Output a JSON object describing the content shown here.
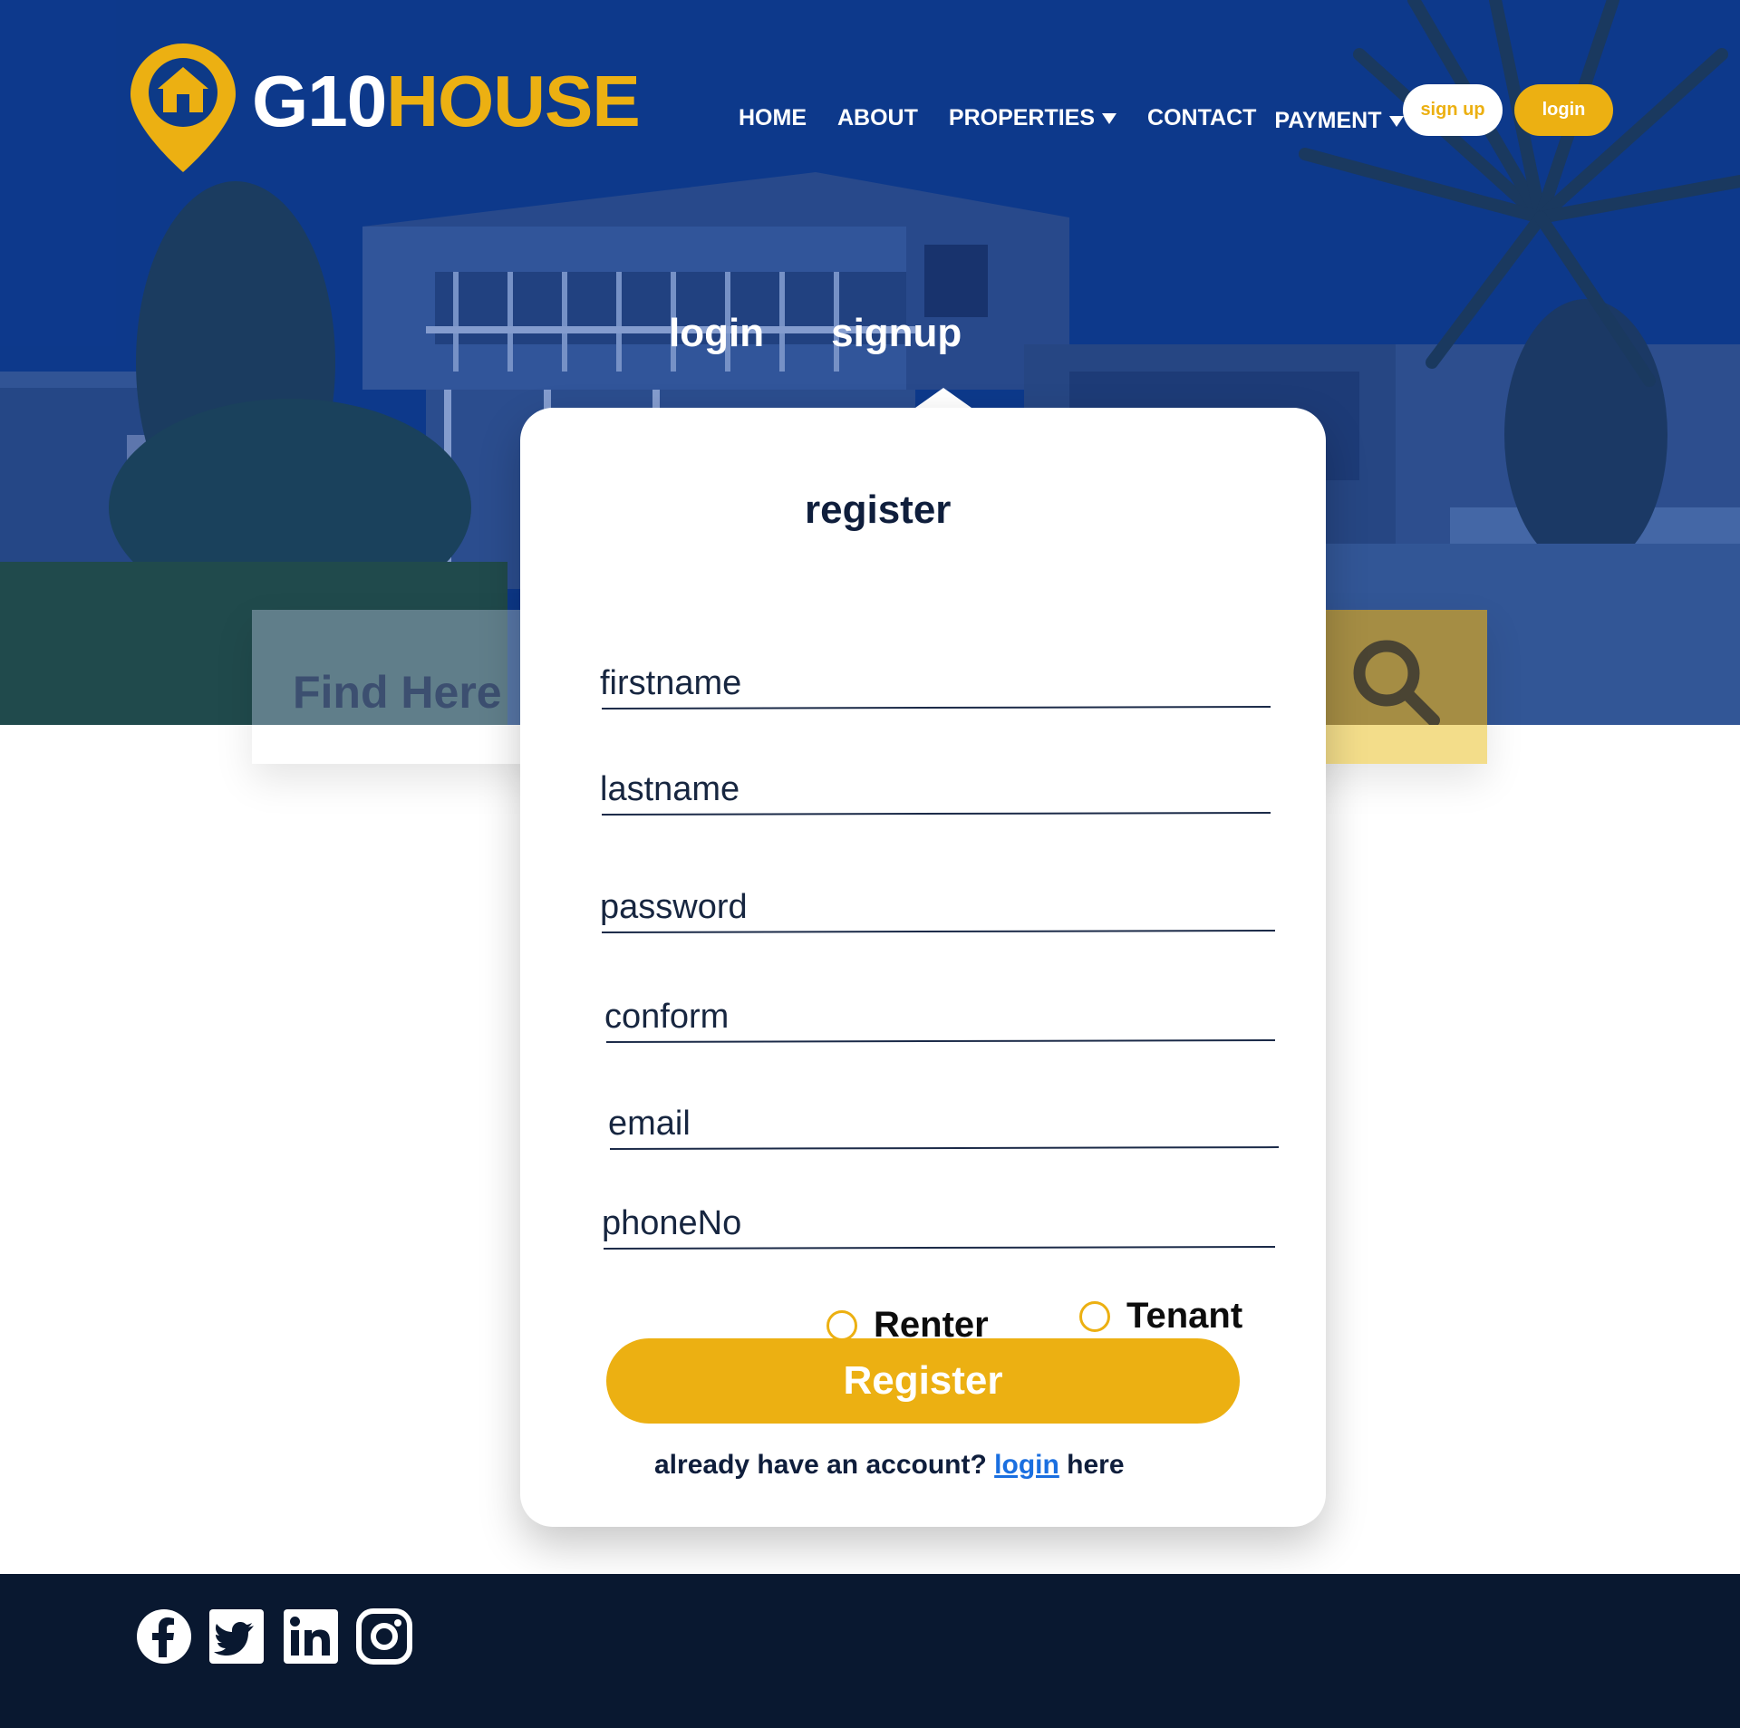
{
  "brand": {
    "part1": "G10",
    "part2": "HOUSE"
  },
  "nav": {
    "items": [
      {
        "label": "HOME"
      },
      {
        "label": "ABOUT"
      },
      {
        "label": "PROPERTIES"
      },
      {
        "label": "CONTACT"
      },
      {
        "label": "PAYMENT"
      }
    ],
    "signup_button": "sign up",
    "login_button": "login"
  },
  "tabs": {
    "login": "login",
    "signup": "signup"
  },
  "search": {
    "placeholder": "Find Here"
  },
  "form": {
    "title": "register",
    "fields": [
      {
        "label": "firstname"
      },
      {
        "label": "lastname"
      },
      {
        "label": "password"
      },
      {
        "label": "conform"
      },
      {
        "label": "email"
      },
      {
        "label": "phoneNo"
      }
    ],
    "roles": [
      {
        "label": "Renter"
      },
      {
        "label": "Tenant"
      }
    ],
    "submit": "Register",
    "account_prefix": "already have an account?",
    "account_link": "login",
    "account_suffix": "here"
  },
  "footer": {
    "social": [
      "facebook-icon",
      "twitter-icon",
      "linkedin-icon",
      "instagram-icon"
    ]
  },
  "colors": {
    "accent": "#ecb012",
    "hero": "#0c3a8a",
    "footer": "#091830",
    "text_dark": "#0f1e3c",
    "link": "#1a6fe0"
  }
}
